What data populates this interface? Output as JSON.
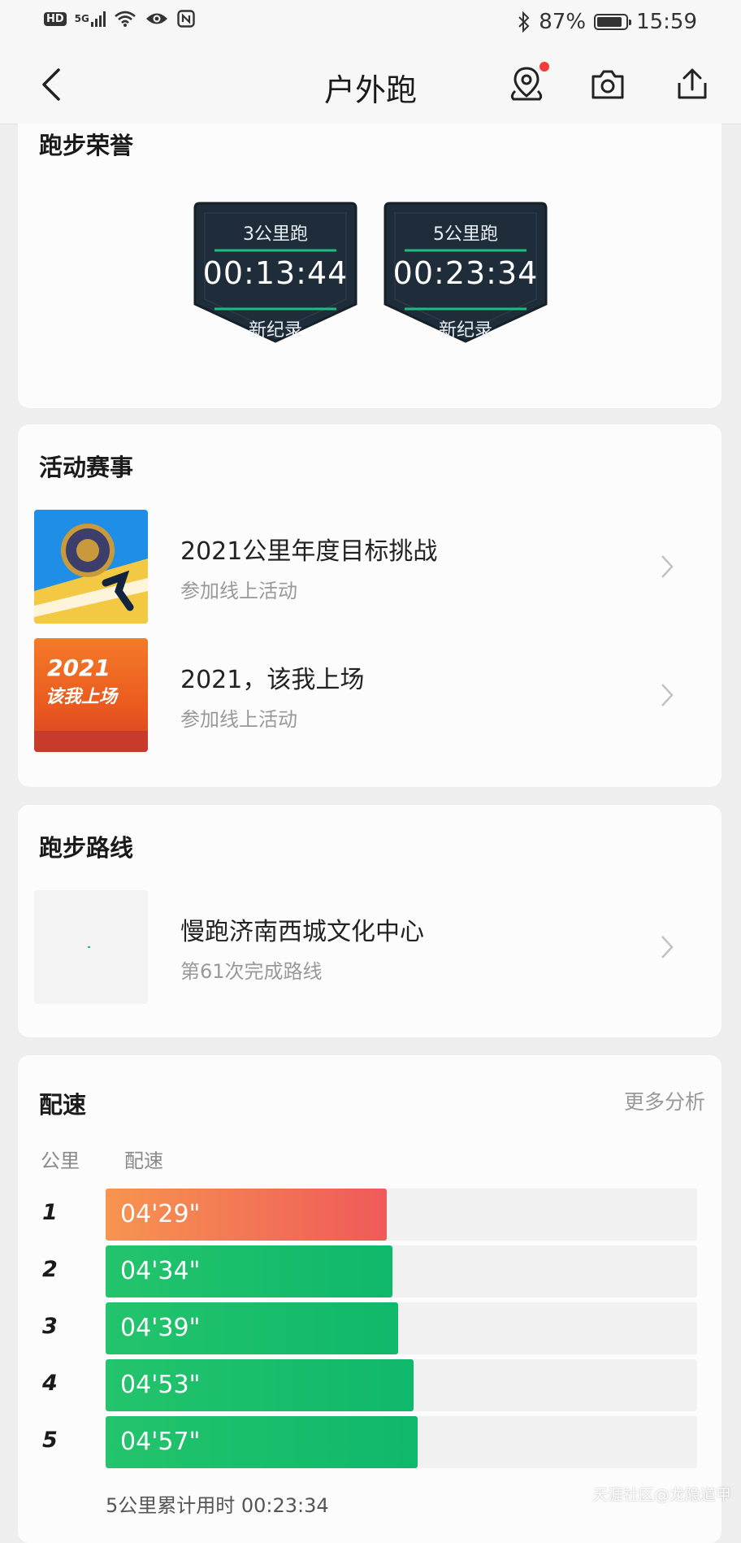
{
  "status_bar": {
    "network": "5G",
    "battery": "87%",
    "battery_level": 0.87,
    "time": "15:59"
  },
  "nav": {
    "title": "户外跑"
  },
  "honors": {
    "title": "跑步荣誉",
    "badges": [
      {
        "label": "3公里跑",
        "time": "00:13:44",
        "note": "新纪录"
      },
      {
        "label": "5公里跑",
        "time": "00:23:34",
        "note": "新纪录"
      }
    ]
  },
  "events": {
    "title": "活动赛事",
    "items": [
      {
        "title": "2021公里年度目标挑战",
        "subtitle": "参加线上活动"
      },
      {
        "title": "2021，该我上场",
        "subtitle": "参加线上活动",
        "thumb_text": "2021",
        "thumb_text2": "该我上场"
      }
    ]
  },
  "route": {
    "title": "跑步路线",
    "item": {
      "title": "慢跑济南西城文化中心",
      "subtitle": "第61次完成路线"
    }
  },
  "pace": {
    "title": "配速",
    "more_label": "更多分析",
    "col_km": "公里",
    "col_pace": "配速",
    "rows": [
      {
        "km": "1",
        "pace": "04'29\"",
        "fraction": 0.475,
        "color": "orange"
      },
      {
        "km": "2",
        "pace": "04'34\"",
        "fraction": 0.485,
        "color": "green"
      },
      {
        "km": "3",
        "pace": "04'39\"",
        "fraction": 0.494,
        "color": "green"
      },
      {
        "km": "4",
        "pace": "04'53\"",
        "fraction": 0.52,
        "color": "green"
      },
      {
        "km": "5",
        "pace": "04'57\"",
        "fraction": 0.528,
        "color": "green"
      }
    ],
    "total": "5公里累计用时 00:23:34"
  },
  "colors": {
    "orange_start": "#f7944f",
    "orange_end": "#ef5a5a",
    "green_start": "#23c46b",
    "green_end": "#10b86b",
    "badge_bg": "#1f2d3a",
    "badge_accent": "#1ebd7c"
  },
  "watermark": "天涯社区@龙隐道甲"
}
